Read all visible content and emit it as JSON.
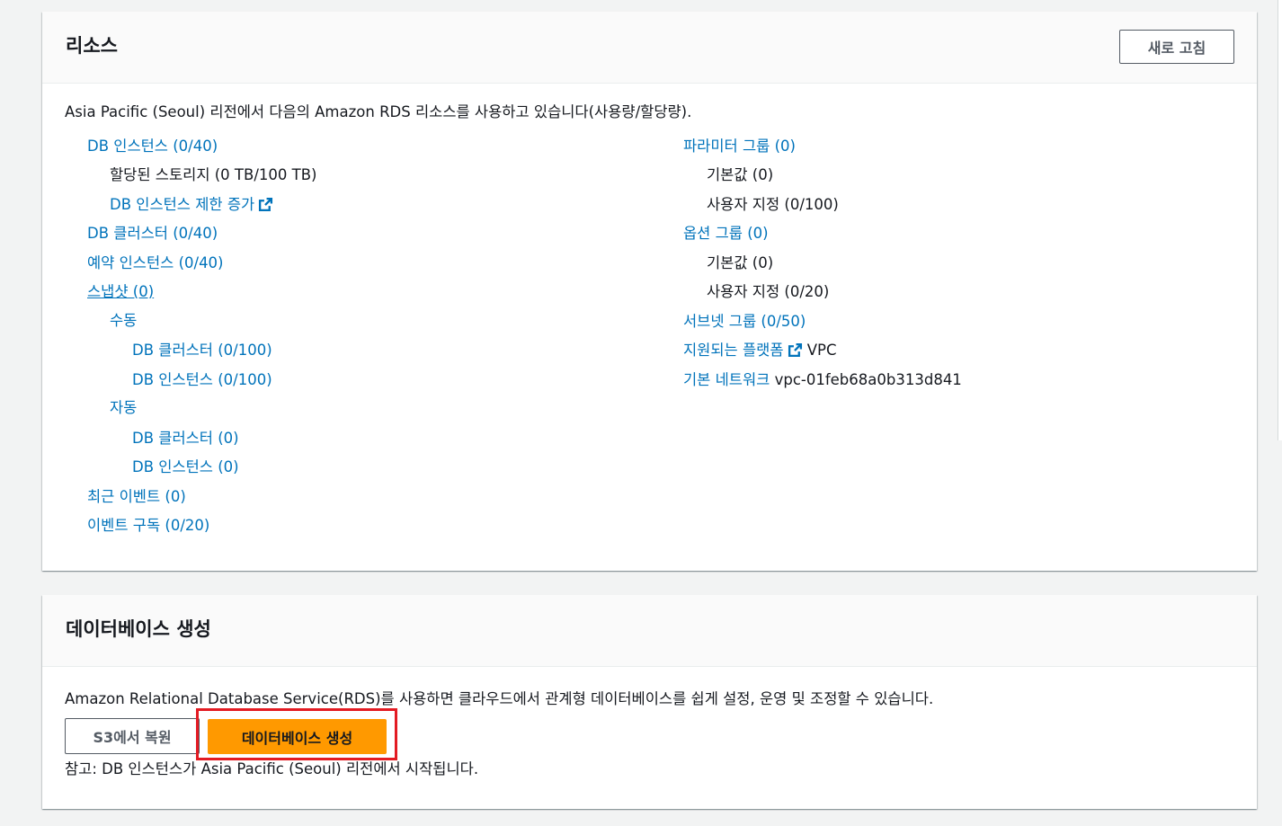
{
  "resources": {
    "title": "리소스",
    "refresh_label": "새로 고침",
    "intro": "Asia Pacific (Seoul) 리전에서 다음의 Amazon RDS 리소스를 사용하고 있습니다(사용량/할당량).",
    "left": {
      "db_instances": "DB 인스턴스 (0/40)",
      "allocated_storage": "할당된 스토리지 (0 TB/100 TB)",
      "increase_limit": "DB 인스턴스 제한 증가",
      "db_clusters": "DB 클러스터 (0/40)",
      "reserved_instances": "예약 인스턴스 (0/40)",
      "snapshots": "스냅샷 (0)",
      "manual": "수동",
      "manual_db_clusters": "DB 클러스터 (0/100)",
      "manual_db_instances": "DB 인스턴스 (0/100)",
      "automated": "자동",
      "auto_db_clusters": "DB 클러스터 (0)",
      "auto_db_instances": "DB 인스턴스 (0)",
      "recent_events": "최근 이벤트 (0)",
      "event_subscriptions": "이벤트 구독 (0/20)"
    },
    "right": {
      "parameter_groups": "파라미터 그룹 (0)",
      "pg_default": "기본값 (0)",
      "pg_custom": "사용자 지정 (0/100)",
      "option_groups": "옵션 그룹 (0)",
      "og_default": "기본값 (0)",
      "og_custom": "사용자 지정 (0/20)",
      "subnet_groups": "서브넷 그룹 (0/50)",
      "supported_platforms": "지원되는 플랫폼",
      "supported_platforms_value": "VPC",
      "default_network": "기본 네트워크",
      "default_network_value": "vpc-01feb68a0b313d841"
    }
  },
  "create_db": {
    "title": "데이터베이스 생성",
    "description": "Amazon Relational Database Service(RDS)를 사용하면 클라우드에서 관계형 데이터베이스를 쉽게 설정, 운영 및 조정할 수 있습니다.",
    "restore_s3_label": "S3에서 복원",
    "create_label": "데이터베이스 생성",
    "note": "참고: DB 인스턴스가 Asia Pacific (Seoul) 리전에서 시작됩니다."
  },
  "colors": {
    "link": "#0073bb",
    "primary_button": "#ff9900",
    "highlight": "#e31b23"
  }
}
